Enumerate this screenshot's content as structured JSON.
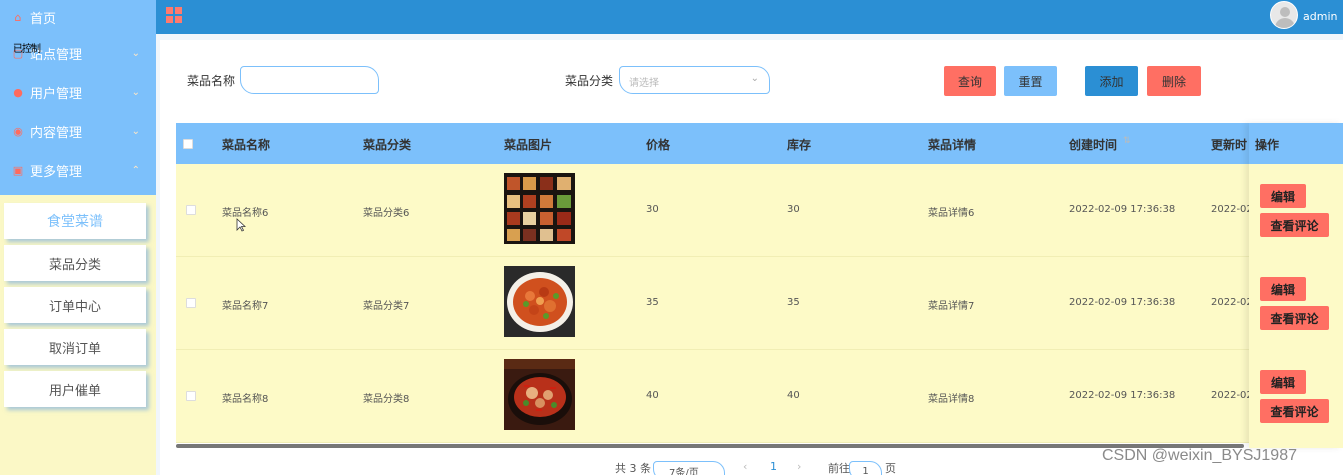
{
  "sidebar": {
    "menu": [
      {
        "label": "首页",
        "icon": "home-icon"
      },
      {
        "label": "站点管理",
        "icon": "monitor-icon"
      },
      {
        "label": "用户管理",
        "icon": "user-icon"
      },
      {
        "label": "内容管理",
        "icon": "content-icon"
      },
      {
        "label": "更多管理",
        "icon": "more-icon"
      }
    ],
    "tooltip": "已控制",
    "submenu": [
      {
        "label": "食堂菜谱",
        "active": true
      },
      {
        "label": "菜品分类"
      },
      {
        "label": "订单中心"
      },
      {
        "label": "取消订单"
      },
      {
        "label": "用户催单"
      }
    ]
  },
  "header": {
    "menu_icon": "grid-icon",
    "username": "admin"
  },
  "filters": {
    "name_label": "菜品名称",
    "name_value": "",
    "category_label": "菜品分类",
    "category_placeholder": "请选择"
  },
  "buttons": {
    "query": "查询",
    "reset": "重置",
    "add": "添加",
    "delete": "删除"
  },
  "colors": {
    "accent": "#7cc0fb",
    "header": "#2b8fd4",
    "danger": "#ff6f63",
    "row_bg": "#fdfac7",
    "primary_button": "#2b8fd4"
  },
  "table": {
    "columns": [
      "菜品名称",
      "菜品分类",
      "菜品图片",
      "价格",
      "库存",
      "菜品详情",
      "创建时间",
      "更新时",
      "操作"
    ],
    "rows": [
      {
        "name": "菜品名称6",
        "category": "菜品分类6",
        "price": "30",
        "stock": "30",
        "detail": "菜品详情6",
        "created": "2022-02-09 17:36:38",
        "updated": "2022-02-",
        "image": "bento-boxes"
      },
      {
        "name": "菜品名称7",
        "category": "菜品分类7",
        "price": "35",
        "stock": "35",
        "detail": "菜品详情7",
        "created": "2022-02-09 17:36:38",
        "updated": "2022-02-",
        "image": "chicken-dish"
      },
      {
        "name": "菜品名称8",
        "category": "菜品分类8",
        "price": "40",
        "stock": "40",
        "detail": "菜品详情8",
        "created": "2022-02-09 17:36:38",
        "updated": "2022-02-",
        "image": "spicy-fish-pot"
      }
    ],
    "row_actions": {
      "edit": "编辑",
      "comments": "查看评论"
    }
  },
  "pagination": {
    "total": "共 3 条",
    "page_size": "7条/页",
    "prev": "‹",
    "current": "1",
    "next": "›",
    "goto_label": "前往",
    "goto_value": "1",
    "page_suffix": "页"
  },
  "watermark": "CSDN @weixin_BYSJ1987"
}
